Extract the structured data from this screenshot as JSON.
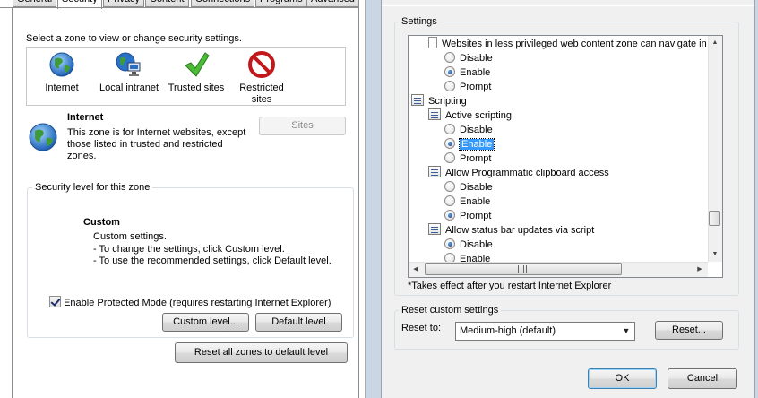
{
  "left": {
    "tabs": [
      "General",
      "Security",
      "Privacy",
      "Content",
      "Connections",
      "Programs",
      "Advanced"
    ],
    "active_tab": "Security",
    "select_zone_text": "Select a zone to view or change security settings.",
    "zones": [
      {
        "label": "Internet",
        "icon": "globe-icon"
      },
      {
        "label": "Local intranet",
        "icon": "intranet-icon"
      },
      {
        "label": "Trusted sites",
        "icon": "check-icon"
      },
      {
        "label": "Restricted sites",
        "icon": "no-entry-icon"
      }
    ],
    "selected_zone": {
      "title": "Internet",
      "description": "This zone is for Internet websites, except those listed in trusted and restricted zones."
    },
    "sites_button": "Sites",
    "security_level_legend": "Security level for this zone",
    "custom_title": "Custom",
    "custom_lines": [
      "Custom settings.",
      "- To change the settings, click Custom level.",
      "- To use the recommended settings, click Default level."
    ],
    "protected_mode_label": "Enable Protected Mode (requires restarting Internet Explorer)",
    "protected_mode_checked": true,
    "custom_level_button": "Custom level...",
    "default_level_button": "Default level",
    "reset_all_button": "Reset all zones to default level"
  },
  "right": {
    "settings_legend": "Settings",
    "tree": [
      {
        "kind": "page",
        "indent": 1,
        "text": "Websites in less privileged web content zone can navigate in"
      },
      {
        "kind": "radio",
        "indent": 2,
        "text": "Disable",
        "checked": false
      },
      {
        "kind": "radio",
        "indent": 2,
        "text": "Enable",
        "checked": true
      },
      {
        "kind": "radio",
        "indent": 2,
        "text": "Prompt",
        "checked": false
      },
      {
        "kind": "gear",
        "indent": 0,
        "text": "Scripting"
      },
      {
        "kind": "gear",
        "indent": 1,
        "text": "Active scripting"
      },
      {
        "kind": "radio",
        "indent": 2,
        "text": "Disable",
        "checked": false
      },
      {
        "kind": "radio",
        "indent": 2,
        "text": "Enable",
        "checked": true,
        "selected": true
      },
      {
        "kind": "radio",
        "indent": 2,
        "text": "Prompt",
        "checked": false
      },
      {
        "kind": "gear",
        "indent": 1,
        "text": "Allow Programmatic clipboard access"
      },
      {
        "kind": "radio",
        "indent": 2,
        "text": "Disable",
        "checked": false
      },
      {
        "kind": "radio",
        "indent": 2,
        "text": "Enable",
        "checked": false
      },
      {
        "kind": "radio",
        "indent": 2,
        "text": "Prompt",
        "checked": true
      },
      {
        "kind": "gear",
        "indent": 1,
        "text": "Allow status bar updates via script"
      },
      {
        "kind": "radio",
        "indent": 2,
        "text": "Disable",
        "checked": true
      },
      {
        "kind": "radio",
        "indent": 2,
        "text": "Enable",
        "checked": false
      }
    ],
    "takes_effect_note": "*Takes effect after you restart Internet Explorer",
    "reset_custom_legend": "Reset custom settings",
    "reset_to_label": "Reset to:",
    "reset_to_value": "Medium-high (default)",
    "reset_button": "Reset...",
    "ok_button": "OK",
    "cancel_button": "Cancel"
  },
  "colors": {
    "selection": "#3399ff",
    "dialog_bg": "#f0f0f0",
    "divider": "#cbd6e5"
  }
}
